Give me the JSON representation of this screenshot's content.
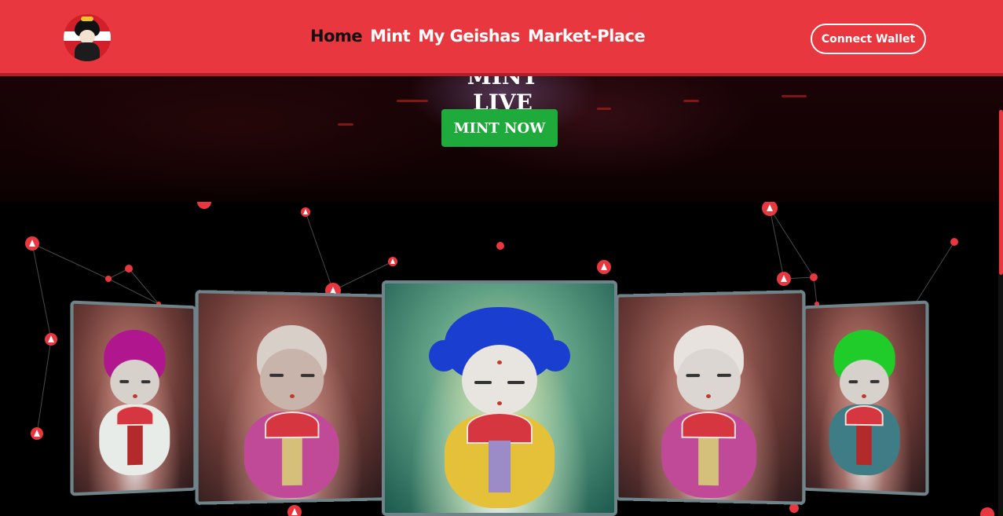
{
  "header": {
    "logo_name": "geisha-logo",
    "nav": [
      {
        "label": "Home",
        "active": true
      },
      {
        "label": "Mint",
        "active": false
      },
      {
        "label": "My Geishas",
        "active": false
      },
      {
        "label": "Market-Place",
        "active": false
      }
    ],
    "connect_label": "Connect Wallet"
  },
  "hero": {
    "title": "MINT LIVE",
    "mint_button_label": "MINT NOW"
  },
  "gallery": {
    "cards": [
      {
        "position": "far-left",
        "hair_color": "#b0178f",
        "kimono_color": "#e7ece9"
      },
      {
        "position": "left",
        "hair_color": "#d9cfc9",
        "kimono_color": "#c04a98"
      },
      {
        "position": "center",
        "hair_color": "#1a3fd0",
        "kimono_color": "#e5c13a"
      },
      {
        "position": "right",
        "hair_color": "#e8e2de",
        "kimono_color": "#c04a98"
      },
      {
        "position": "far-right",
        "hair_color": "#1fcc2a",
        "kimono_color": "#3f7d86"
      }
    ]
  },
  "colors": {
    "brand_red": "#e8373f",
    "mint_green": "#1faa3c",
    "background": "#000000"
  },
  "icons": [
    "avalanche-node-icon"
  ]
}
